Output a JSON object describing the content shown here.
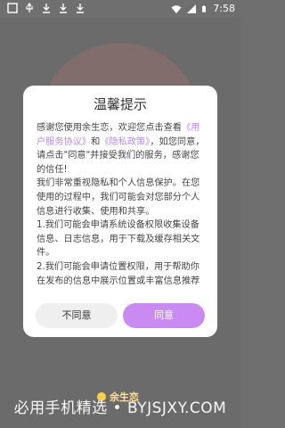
{
  "statusbar": {
    "time": "7:58",
    "left_icons": [
      "screenshot-icon",
      "usb-icon",
      "download-icon",
      "download-icon",
      "download-icon"
    ],
    "right_icons": [
      "wifi-icon",
      "signal-icon",
      "battery-icon"
    ]
  },
  "dialog": {
    "title": "温馨提示",
    "body": {
      "p1_prefix": "感谢您使用余生恋，欢迎您点击查看",
      "link_user_agreement": "《用户服务协议》",
      "and": "和",
      "link_privacy": "《隐私政策》",
      "p1_suffix": "，如您同意，请点击\"同意\"并接受我们的服务，感谢您的信任!",
      "p2": "我们非常重视隐私和个人信息保护。在您使用的过程中，我们可能会对您部分个人信息进行收集、使用和共享。",
      "p3": "1.我们可能会申请系统设备权限收集设备信息、日志信息，用于下载及缓存相关文件。",
      "p4": "2.我们可能会申请位置权限，用于帮助你在发布的信息中展示位置或丰富信息推荐"
    },
    "buttons": {
      "disagree": "不同意",
      "agree": "同意"
    }
  },
  "background": {
    "logo_text": "余生恋"
  },
  "watermark": "必用手机精选 • BYJSJXY.COM"
}
